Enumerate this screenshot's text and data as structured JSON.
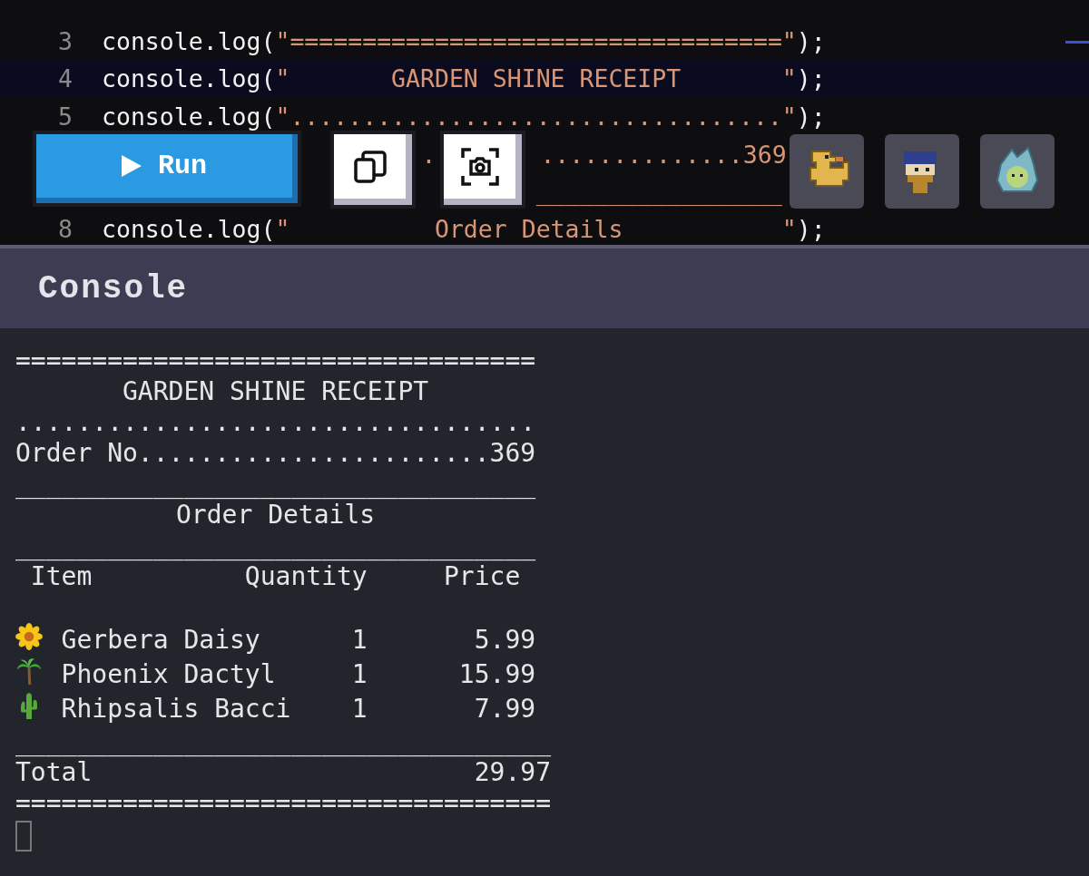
{
  "editor": {
    "lines": [
      {
        "number": "3",
        "code": "console.log(\"==================================\");",
        "current": false
      },
      {
        "number": "4",
        "code": "console.log(\"       GARDEN SHINE RECEIPT       \");",
        "current": true
      },
      {
        "number": "5",
        "code": "console.log(\"..................................\");",
        "current": false
      },
      {
        "fragments": [
          ".",
          "..............369"
        ],
        "current": false
      },
      {
        "fragments": [
          "_________________"
        ],
        "current": false
      },
      {
        "number": "8",
        "code": "console.log(\"          Order Details           \");",
        "current": false
      }
    ]
  },
  "toolbar": {
    "run_button": {
      "label": "Run"
    }
  },
  "console": {
    "title": "Console",
    "lines": [
      {
        "kind": "text",
        "text": "=================================="
      },
      {
        "kind": "centered",
        "text": "GARDEN SHINE RECEIPT"
      },
      {
        "kind": "text",
        "text": ".................................."
      },
      {
        "kind": "text",
        "text": "Order No.......................369"
      },
      {
        "kind": "text",
        "text": "__________________________________"
      },
      {
        "kind": "centered",
        "text": "Order Details"
      },
      {
        "kind": "text",
        "text": "__________________________________"
      },
      {
        "kind": "header",
        "columns": [
          "Item",
          "Quantity",
          "Price"
        ]
      },
      {
        "kind": "item",
        "name": "Gerbera Daisy",
        "quantity": "1",
        "price": "5.99"
      },
      {
        "kind": "item",
        "name": "Phoenix Dactyl",
        "quantity": "1",
        "price": "15.99"
      },
      {
        "kind": "item",
        "name": "Rhipsalis Bacci",
        "quantity": "1",
        "price": "7.99"
      },
      {
        "kind": "text",
        "text": "___________________________________"
      },
      {
        "kind": "total",
        "label": "Total",
        "value": "29.97"
      },
      {
        "kind": "text",
        "text": "==================================="
      }
    ]
  }
}
